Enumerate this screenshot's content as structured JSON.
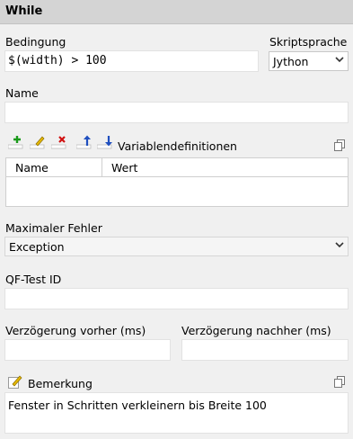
{
  "header": {
    "title": "While"
  },
  "condition": {
    "label": "Bedingung",
    "value": "$(width) > 100"
  },
  "script_language": {
    "label": "Skriptsprache",
    "selected": "Jython"
  },
  "name": {
    "label": "Name",
    "value": ""
  },
  "variables": {
    "label": "Variablendefinitionen",
    "toolbar": [
      "add-icon",
      "edit-icon",
      "delete-icon",
      "move-up-icon",
      "move-down-icon"
    ],
    "columns": [
      "Name",
      "Wert"
    ],
    "rows": []
  },
  "max_error": {
    "label": "Maximaler Fehler",
    "selected": "Exception"
  },
  "qftest_id": {
    "label": "QF-Test ID",
    "value": ""
  },
  "delay_before": {
    "label": "Verzögerung vorher (ms)",
    "value": ""
  },
  "delay_after": {
    "label": "Verzögerung nachher (ms)",
    "value": ""
  },
  "comment": {
    "label": "Bemerkung",
    "value": "Fenster in Schritten verkleinern bis Breite 100"
  },
  "colors": {
    "header_bg": "#d4d4d4",
    "add_green": "#1a9a1a",
    "delete_red": "#d01010",
    "arrow_blue": "#1f4fbf",
    "pencil_yellow": "#e6b800"
  }
}
